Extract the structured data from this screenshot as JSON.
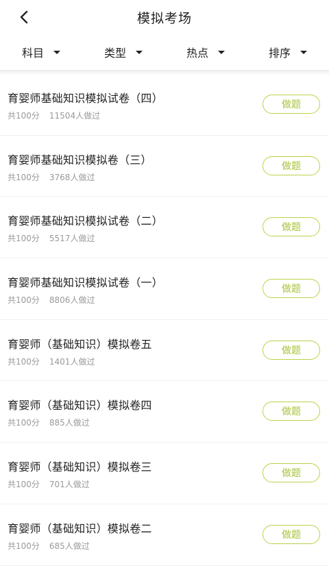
{
  "header": {
    "title": "模拟考场",
    "back_icon": "chevron-left-icon"
  },
  "filters": [
    {
      "label": "科目"
    },
    {
      "label": "类型"
    },
    {
      "label": "热点"
    },
    {
      "label": "排序"
    }
  ],
  "exams": [
    {
      "title": "育婴师基础知识模拟试卷（四）",
      "score": "共100分",
      "count": "11504人做过",
      "action": "做题"
    },
    {
      "title": "育婴师基础知识模拟卷（三）",
      "score": "共100分",
      "count": "3768人做过",
      "action": "做题"
    },
    {
      "title": "育婴师基础知识模拟试卷（二）",
      "score": "共100分",
      "count": "5517人做过",
      "action": "做题"
    },
    {
      "title": "育婴师基础知识模拟试卷（一）",
      "score": "共100分",
      "count": "8806人做过",
      "action": "做题"
    },
    {
      "title": "育婴师（基础知识）模拟卷五",
      "score": "共100分",
      "count": "1401人做过",
      "action": "做题"
    },
    {
      "title": "育婴师（基础知识）模拟卷四",
      "score": "共100分",
      "count": "885人做过",
      "action": "做题"
    },
    {
      "title": "育婴师（基础知识）模拟卷三",
      "score": "共100分",
      "count": "701人做过",
      "action": "做题"
    },
    {
      "title": "育婴师（基础知识）模拟卷二",
      "score": "共100分",
      "count": "685人做过",
      "action": "做题"
    }
  ],
  "colors": {
    "accent": "#a7c43a"
  }
}
